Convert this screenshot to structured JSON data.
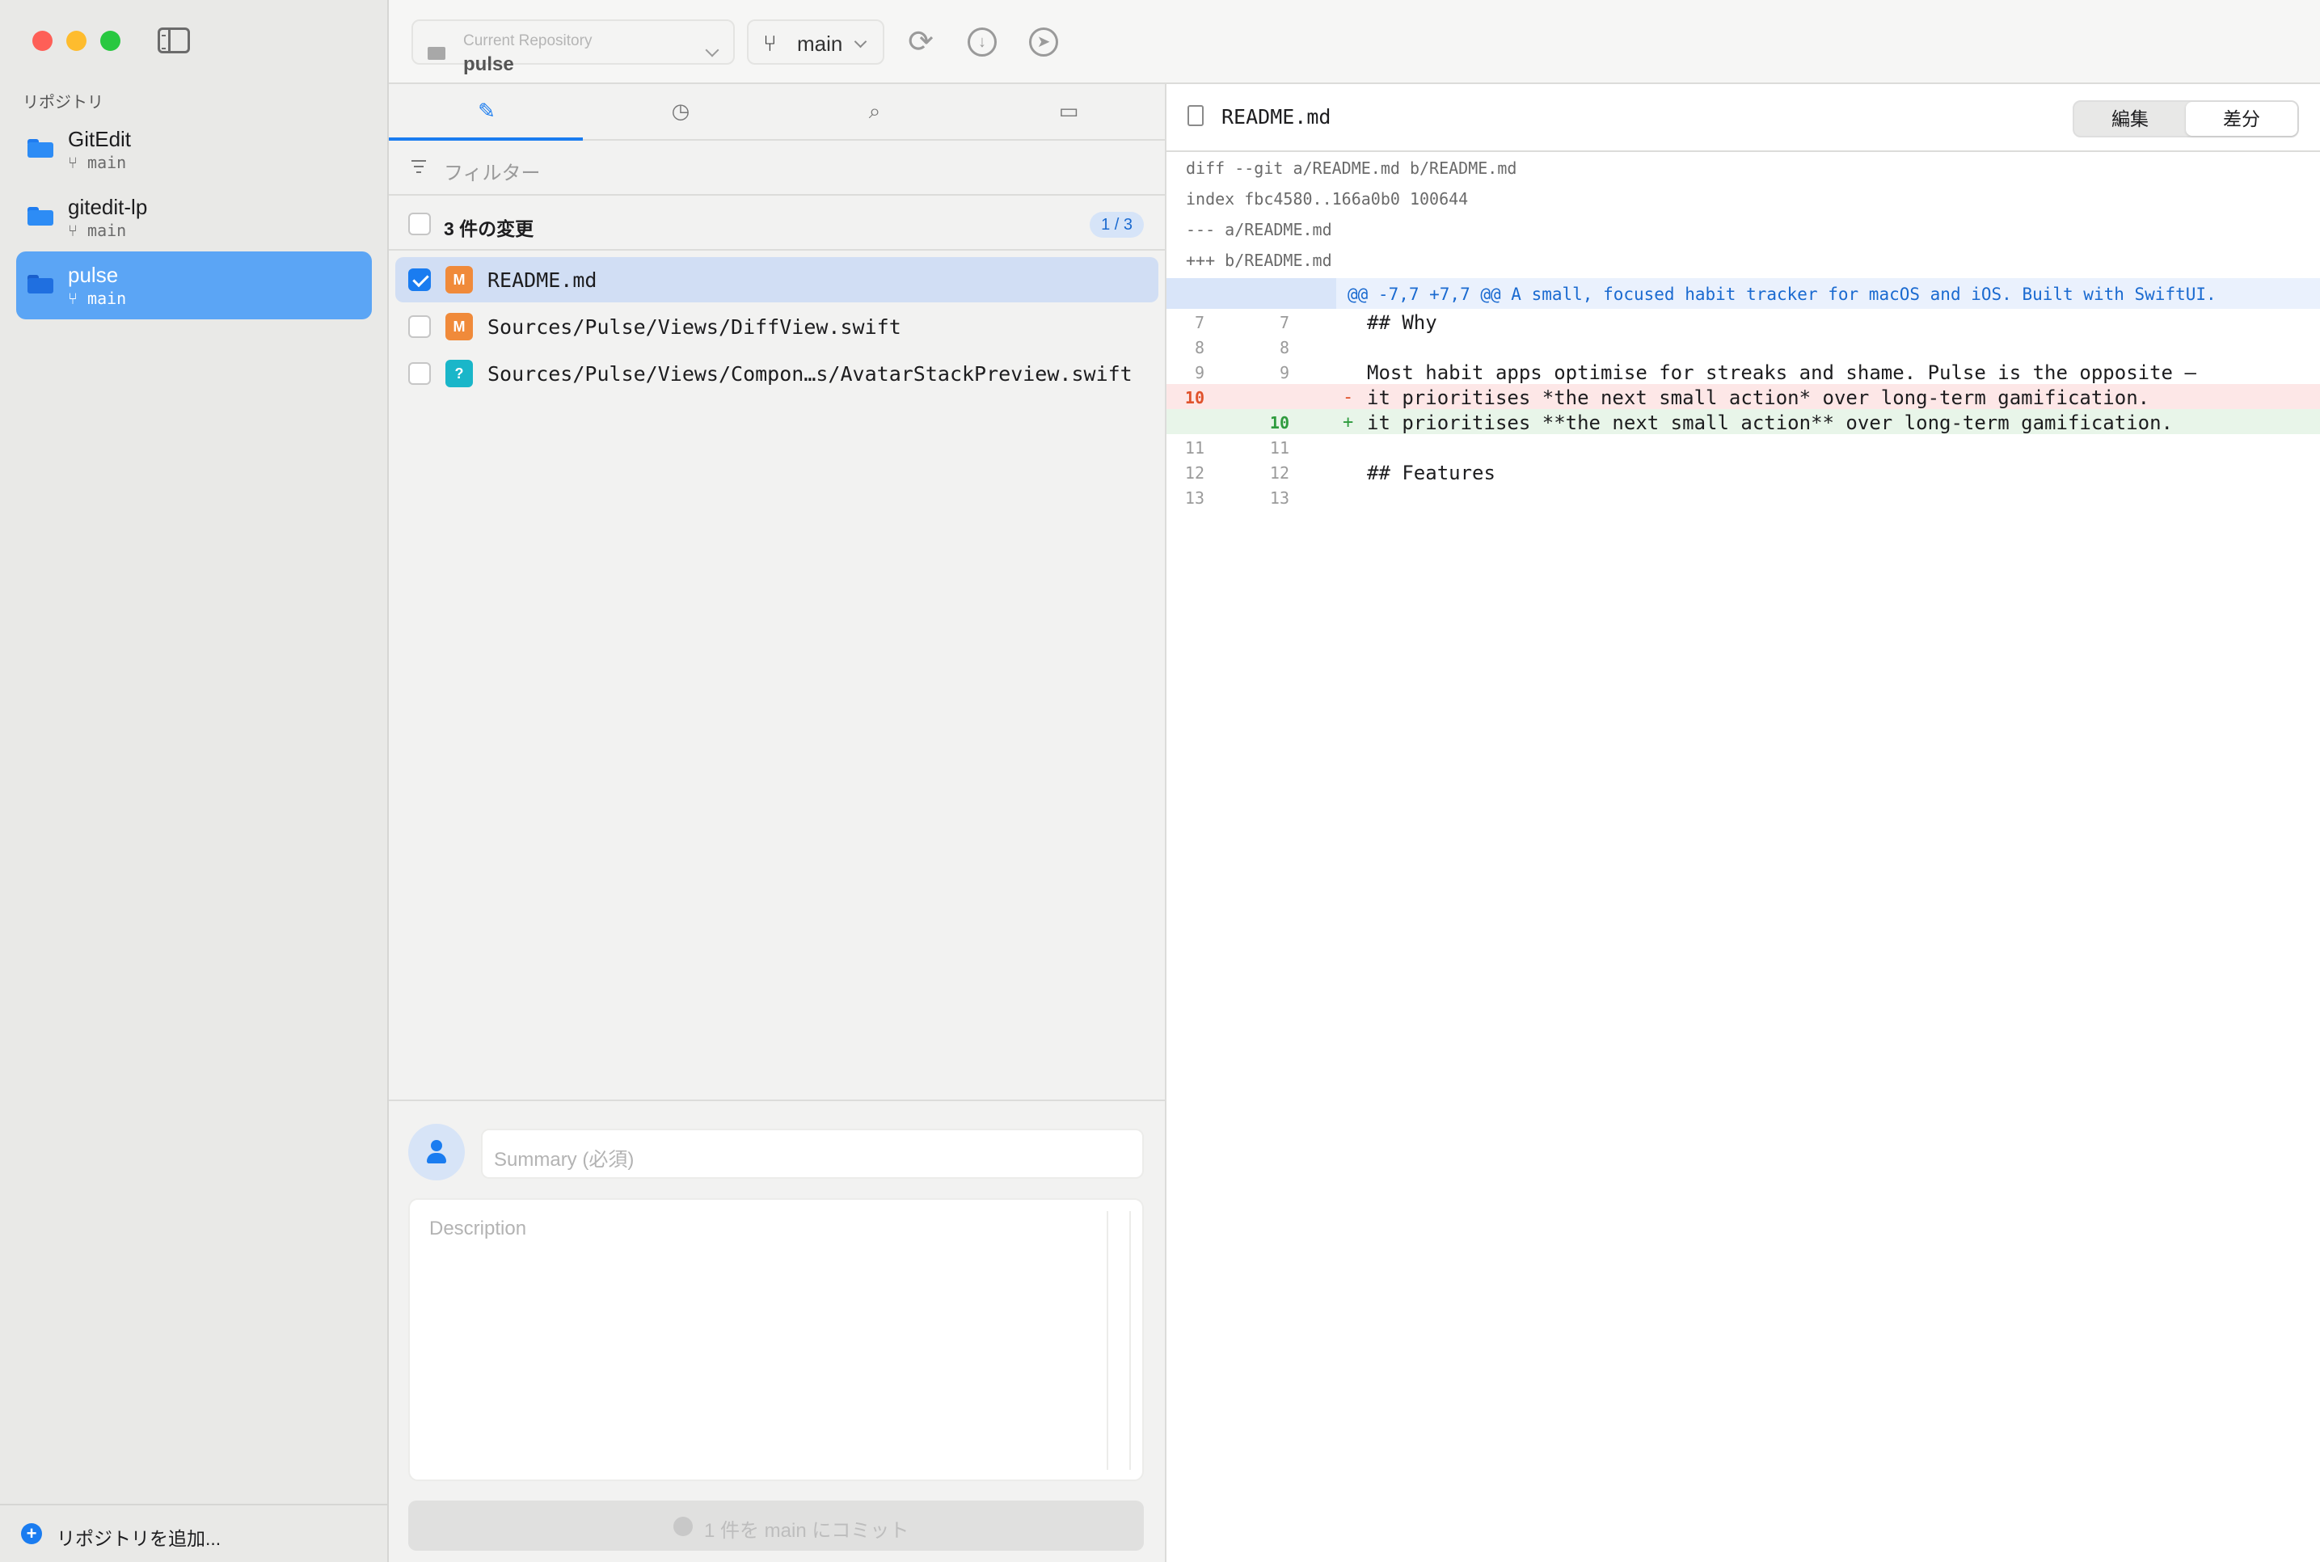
{
  "sidebar": {
    "section_label": "リポジトリ",
    "repos": [
      {
        "name": "GitEdit",
        "branch": "main"
      },
      {
        "name": "gitedit-lp",
        "branch": "main"
      },
      {
        "name": "pulse",
        "branch": "main"
      }
    ],
    "add_repo_label": "リポジトリを追加..."
  },
  "toolbar": {
    "current_repo_caption": "Current Repository",
    "current_repo_value": "pulse",
    "branch_label": "main"
  },
  "changes": {
    "filter_placeholder": "フィルター",
    "header_label": "3 件の変更",
    "count_badge": "1 / 3",
    "files": [
      {
        "badge": "M",
        "path": "README.md",
        "checked": true
      },
      {
        "badge": "M",
        "path": "Sources/Pulse/Views/DiffView.swift",
        "checked": false
      },
      {
        "badge": "?",
        "path": "Sources/Pulse/Views/Compon…s/AvatarStackPreview.swift",
        "checked": false
      }
    ]
  },
  "commit": {
    "summary_placeholder": "Summary (必須)",
    "description_placeholder": "Description",
    "button_label": "1 件を main にコミット"
  },
  "diff": {
    "file_name": "README.md",
    "mode_edit": "編集",
    "mode_diff": "差分",
    "meta": [
      "diff --git a/README.md b/README.md",
      "index fbc4580..166a0b0 100644",
      "--- a/README.md",
      "+++ b/README.md"
    ],
    "hunk_header": "@@ -7,7 +7,7 @@ A small, focused habit tracker for macOS and iOS. Built with SwiftUI.",
    "lines": [
      {
        "old": "7",
        "new": "7",
        "sign": "",
        "text": "## Why"
      },
      {
        "old": "8",
        "new": "8",
        "sign": "",
        "text": ""
      },
      {
        "old": "9",
        "new": "9",
        "sign": "",
        "text": "Most habit apps optimise for streaks and shame. Pulse is the opposite —"
      },
      {
        "old": "10",
        "new": "",
        "sign": "-",
        "text": "it prioritises *the next small action* over long-term gamification."
      },
      {
        "old": "",
        "new": "10",
        "sign": "+",
        "text": "it prioritises **the next small action** over long-term gamification."
      },
      {
        "old": "11",
        "new": "11",
        "sign": "",
        "text": ""
      },
      {
        "old": "12",
        "new": "12",
        "sign": "",
        "text": "## Features"
      },
      {
        "old": "13",
        "new": "13",
        "sign": "",
        "text": ""
      }
    ]
  }
}
